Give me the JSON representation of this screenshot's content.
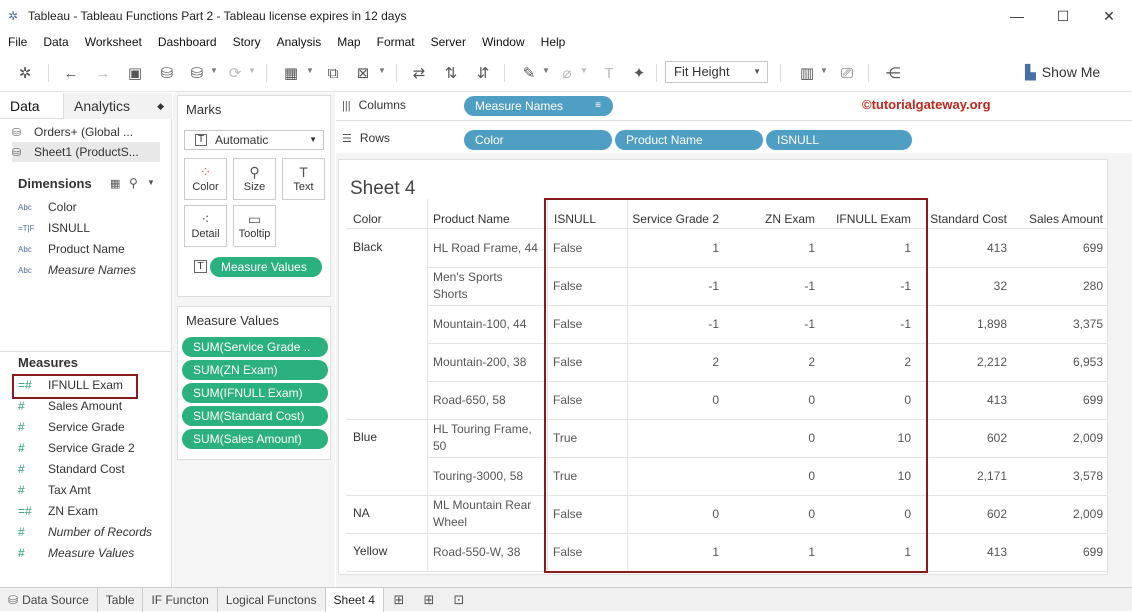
{
  "window": {
    "title": "Tableau - Tableau Functions Part 2 - Tableau license expires in 12 days",
    "controls": [
      "—",
      "☐",
      "✕"
    ]
  },
  "menu": [
    "File",
    "Data",
    "Worksheet",
    "Dashboard",
    "Story",
    "Analysis",
    "Map",
    "Format",
    "Server",
    "Window",
    "Help"
  ],
  "toolbar": {
    "fit": "Fit Height",
    "show_me": "Show Me"
  },
  "datapane": {
    "tab_data": "Data",
    "tab_analytics": "Analytics",
    "sources": [
      "Orders+ (Global ...",
      "Sheet1 (ProductS..."
    ],
    "dimensions_header": "Dimensions",
    "dimensions": [
      {
        "icon": "Abc",
        "label": "Color"
      },
      {
        "icon": "=T|F",
        "label": "ISNULL"
      },
      {
        "icon": "Abc",
        "label": "Product Name"
      },
      {
        "icon": "Abc",
        "label": "Measure Names"
      }
    ],
    "measures_header": "Measures",
    "measures": [
      {
        "icon": "=#",
        "label": "IFNULL Exam"
      },
      {
        "icon": "#",
        "label": "Sales Amount"
      },
      {
        "icon": "#",
        "label": "Service Grade"
      },
      {
        "icon": "#",
        "label": "Service Grade 2"
      },
      {
        "icon": "#",
        "label": "Standard Cost"
      },
      {
        "icon": "#",
        "label": "Tax Amt"
      },
      {
        "icon": "=#",
        "label": "ZN Exam"
      },
      {
        "icon": "#",
        "label": "Number of Records"
      },
      {
        "icon": "#",
        "label": "Measure Values"
      }
    ]
  },
  "marks": {
    "title": "Marks",
    "type": "Automatic",
    "buttons": [
      "Color",
      "Size",
      "Text",
      "Detail",
      "Tooltip"
    ],
    "text_pill": "Measure Values"
  },
  "measure_values": {
    "title": "Measure Values",
    "pills": [
      "SUM(Service Grade ..",
      "SUM(ZN Exam)",
      "SUM(IFNULL Exam)",
      "SUM(Standard Cost)",
      "SUM(Sales Amount)"
    ]
  },
  "shelves": {
    "columns_label": "Columns",
    "columns_pills": [
      "Measure Names"
    ],
    "rows_label": "Rows",
    "rows_pills": [
      "Color",
      "Product Name",
      "ISNULL"
    ],
    "watermark": "©tutorialgateway.org"
  },
  "sheet": {
    "title": "Sheet 4",
    "headers": [
      "Color",
      "Product Name",
      "ISNULL",
      "Service Grade 2",
      "ZN Exam",
      "IFNULL Exam",
      "Standard Cost",
      "Sales Amount"
    ],
    "rows": [
      {
        "color": "Black",
        "product": [
          "HL Road Frame, 44"
        ],
        "isnull": "False",
        "sg2": "1",
        "zn": "1",
        "ifnull": "1",
        "cost": "413",
        "sales": "699"
      },
      {
        "color": "",
        "product": [
          "Men's Sports",
          "Shorts"
        ],
        "isnull": "False",
        "sg2": "-1",
        "zn": "-1",
        "ifnull": "-1",
        "cost": "32",
        "sales": "280"
      },
      {
        "color": "",
        "product": [
          "Mountain-100, 44"
        ],
        "isnull": "False",
        "sg2": "-1",
        "zn": "-1",
        "ifnull": "-1",
        "cost": "1,898",
        "sales": "3,375"
      },
      {
        "color": "",
        "product": [
          "Mountain-200, 38"
        ],
        "isnull": "False",
        "sg2": "2",
        "zn": "2",
        "ifnull": "2",
        "cost": "2,212",
        "sales": "6,953"
      },
      {
        "color": "",
        "product": [
          "Road-650, 58"
        ],
        "isnull": "False",
        "sg2": "0",
        "zn": "0",
        "ifnull": "0",
        "cost": "413",
        "sales": "699"
      },
      {
        "color": "Blue",
        "product": [
          "HL Touring Frame,",
          "50"
        ],
        "isnull": "True",
        "sg2": "",
        "zn": "0",
        "ifnull": "10",
        "cost": "602",
        "sales": "2,009"
      },
      {
        "color": "",
        "product": [
          "Touring-3000, 58"
        ],
        "isnull": "True",
        "sg2": "",
        "zn": "0",
        "ifnull": "10",
        "cost": "2,171",
        "sales": "3,578"
      },
      {
        "color": "NA",
        "product": [
          "ML Mountain Rear",
          "Wheel"
        ],
        "isnull": "False",
        "sg2": "0",
        "zn": "0",
        "ifnull": "0",
        "cost": "602",
        "sales": "2,009"
      },
      {
        "color": "Yellow",
        "product": [
          "Road-550-W, 38"
        ],
        "isnull": "False",
        "sg2": "1",
        "zn": "1",
        "ifnull": "1",
        "cost": "413",
        "sales": "699"
      }
    ]
  },
  "bottom_tabs": [
    "Data Source",
    "Table",
    "IF Functon",
    "Logical Functons",
    "Sheet 4"
  ],
  "colors": {
    "pill_green": "#2bb07f",
    "pill_blue": "#4f9ec4",
    "highlight": "#8b1a1a"
  }
}
